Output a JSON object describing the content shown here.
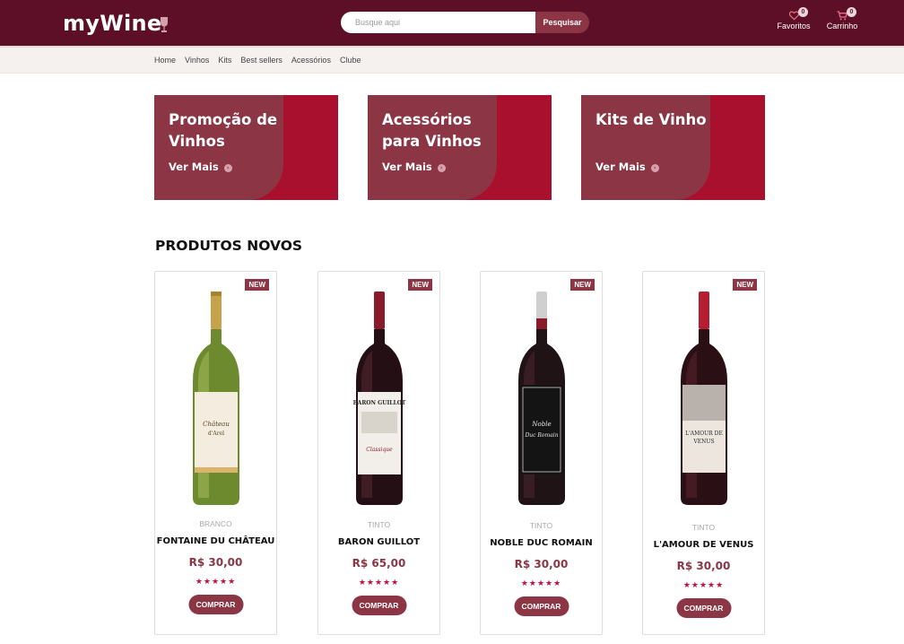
{
  "header": {
    "logo": "myWine",
    "search_placeholder": "Busque aqui",
    "search_button": "Pesquisar",
    "favorites_label": "Favoritos",
    "favorites_count": "0",
    "cart_label": "Carrinho",
    "cart_count": "0",
    "background_color": "#5c0f26"
  },
  "nav": {
    "items": [
      "Home",
      "Vinhos",
      "Kits",
      "Best sellers",
      "Acessórios",
      "Clube"
    ]
  },
  "promos": [
    {
      "title": "Promoção de Vinhos",
      "cta": "Ver Mais"
    },
    {
      "title": "Acessórios para Vinhos",
      "cta": "Ver Mais"
    },
    {
      "title": "Kits de Vinho",
      "cta": "Ver Mais"
    }
  ],
  "section_title": "PRODUTOS NOVOS",
  "products": [
    {
      "badge": "NEW",
      "type": "BRANCO",
      "name": "FONTAINE DU CHÂTEAU",
      "price": "R$ 30,00",
      "stars": "★★★★★",
      "rating": 5,
      "buy": "COMPRAR",
      "bottle": "white-wine-bottle"
    },
    {
      "badge": "NEW",
      "type": "TINTO",
      "name": "BARON GUILLOT",
      "price": "R$ 65,00",
      "stars": "★★★★★",
      "rating": 5,
      "buy": "COMPRAR",
      "bottle": "red-wine-bottle"
    },
    {
      "badge": "NEW",
      "type": "TINTO",
      "name": "NOBLE DUC ROMAIN",
      "price": "R$ 30,00",
      "stars": "★★★★★",
      "rating": 5,
      "buy": "COMPRAR",
      "bottle": "red-wine-bottle"
    },
    {
      "badge": "NEW",
      "type": "TINTO",
      "name": "L'AMOUR DE VENUS",
      "price": "R$ 30,00",
      "stars": "★★★★★",
      "rating": 5,
      "buy": "COMPRAR",
      "bottle": "red-wine-bottle"
    }
  ],
  "colors": {
    "brand_dark": "#5c0f26",
    "brand": "#8b3545",
    "promo_accent": "#a8102e",
    "star": "#c2103c"
  }
}
